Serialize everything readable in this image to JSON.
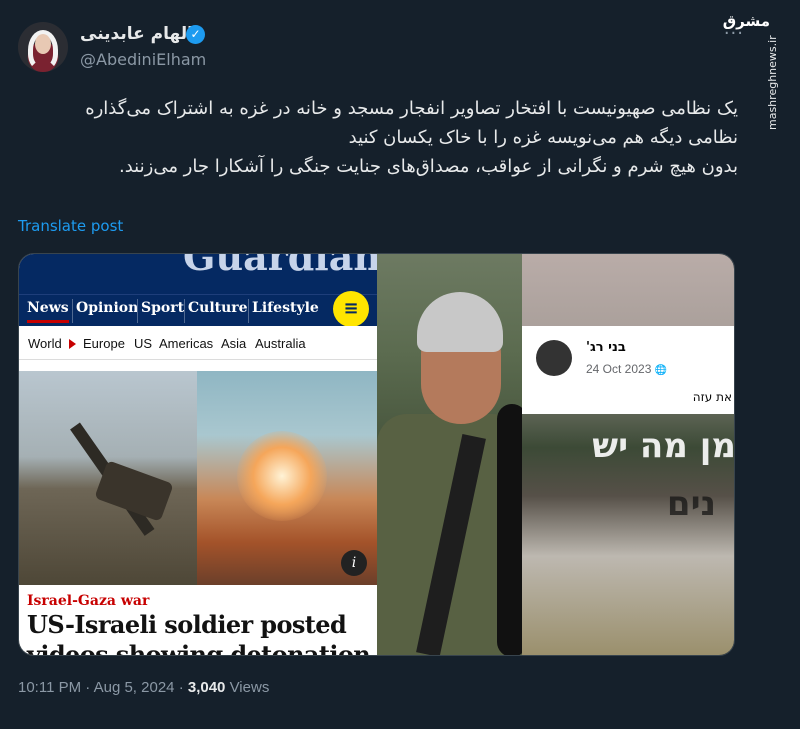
{
  "author": {
    "display_name": "الهام عابدینی",
    "handle": "@AbediniElham",
    "verified_icon": "✓",
    "verified_color": "#1d9bf0"
  },
  "header": {
    "more_label": "...",
    "site_logo": "مشرق",
    "site_watermark": "mashreghnews.ir"
  },
  "tweet": {
    "lines": [
      "یک نظامی صهیونیست با افتخار تصاویر انفجار مسجد و خانه در غزه به اشتراک می‌گذاره",
      "نظامی دیگه هم می‌نویسه غزه را با خاک یکسان کنید",
      "بدون هیچ شرم و نگرانی از عواقب، مصداق‌های جنایت جنگی را آشکارا جار می‌زنند."
    ],
    "translate_label": "Translate post"
  },
  "media": {
    "guardian": {
      "masthead": "Guardian",
      "nav": [
        "News",
        "Opinion",
        "Sport",
        "Culture",
        "Lifestyle"
      ],
      "menu_icon": "≡",
      "subnav": [
        "World",
        "Europe",
        "US",
        "Americas",
        "Asia",
        "Australia"
      ],
      "info_icon": "i",
      "kicker": "Israel-Gaza war",
      "headline_lines": [
        "US-Israeli soldier posted",
        "videos showing detonation"
      ],
      "brand_color": "#052962",
      "accent_color": "#c70000"
    },
    "facebook": {
      "name": "בני רג'",
      "date": "24 Oct 2023",
      "globe_icon": "🌐",
      "text": "את עזה",
      "overlay_1": "מן מה יש",
      "overlay_2": "נים"
    }
  },
  "meta": {
    "time": "10:11 PM",
    "sep": "·",
    "date": "Aug 5, 2024",
    "views_count": "3,040",
    "views_label": "Views"
  }
}
